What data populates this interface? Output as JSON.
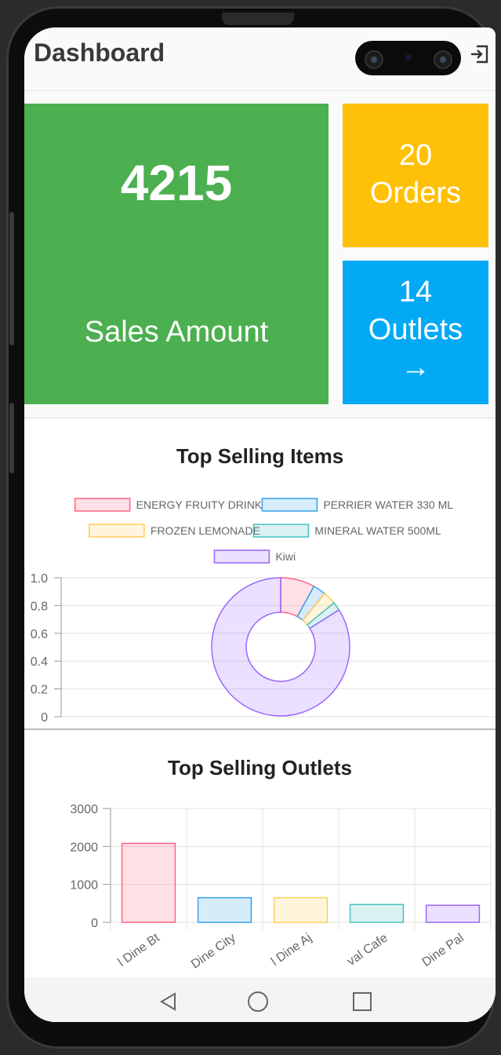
{
  "appbar": {
    "title": "Dashboard",
    "logout_icon": "logout-icon"
  },
  "tiles": {
    "sales": {
      "value": "4215",
      "label": "Sales Amount",
      "color": "#4caf50"
    },
    "orders": {
      "value": "20",
      "label": "Orders",
      "color": "#ffc107"
    },
    "outlets": {
      "value": "14",
      "label": "Outlets",
      "arrow": "→",
      "color": "#03a9f4"
    }
  },
  "chart_data": [
    {
      "type": "pie",
      "title": "Top Selling Items",
      "variant": "doughnut",
      "legend_position": "top",
      "labels": [
        "ENERGY FRUITY DRINK",
        "PERRIER WATER 330 ML",
        "FROZEN LEMONADE",
        "MINERAL WATER 500ML",
        "Kiwi"
      ],
      "values": [
        8,
        3,
        3,
        2,
        84
      ],
      "colors": [
        "#ff6384",
        "#36a2eb",
        "#ffce56",
        "#4bc0c0",
        "#9966ff"
      ],
      "y_ticks": [
        "1.0",
        "0.8",
        "0.6",
        "0.4",
        "0.2",
        "0"
      ],
      "ylim": [
        0,
        1
      ],
      "grid": true
    },
    {
      "type": "bar",
      "title": "Top Selling Outlets",
      "categories": [
        "l Dine Bt",
        "Dine City",
        "l Dine Aj",
        "val Cafe",
        "Dine Pal"
      ],
      "values": [
        2080,
        650,
        650,
        470,
        450
      ],
      "colors": [
        "#ff6384",
        "#36a2eb",
        "#ffce56",
        "#4bc0c0",
        "#9966ff"
      ],
      "y_ticks": [
        "3000",
        "2000",
        "1000",
        "0"
      ],
      "ylim": [
        0,
        3000
      ],
      "grid": true
    }
  ],
  "navbar": {
    "back_icon": "back-icon",
    "home_icon": "home-icon",
    "recents_icon": "recents-icon"
  }
}
